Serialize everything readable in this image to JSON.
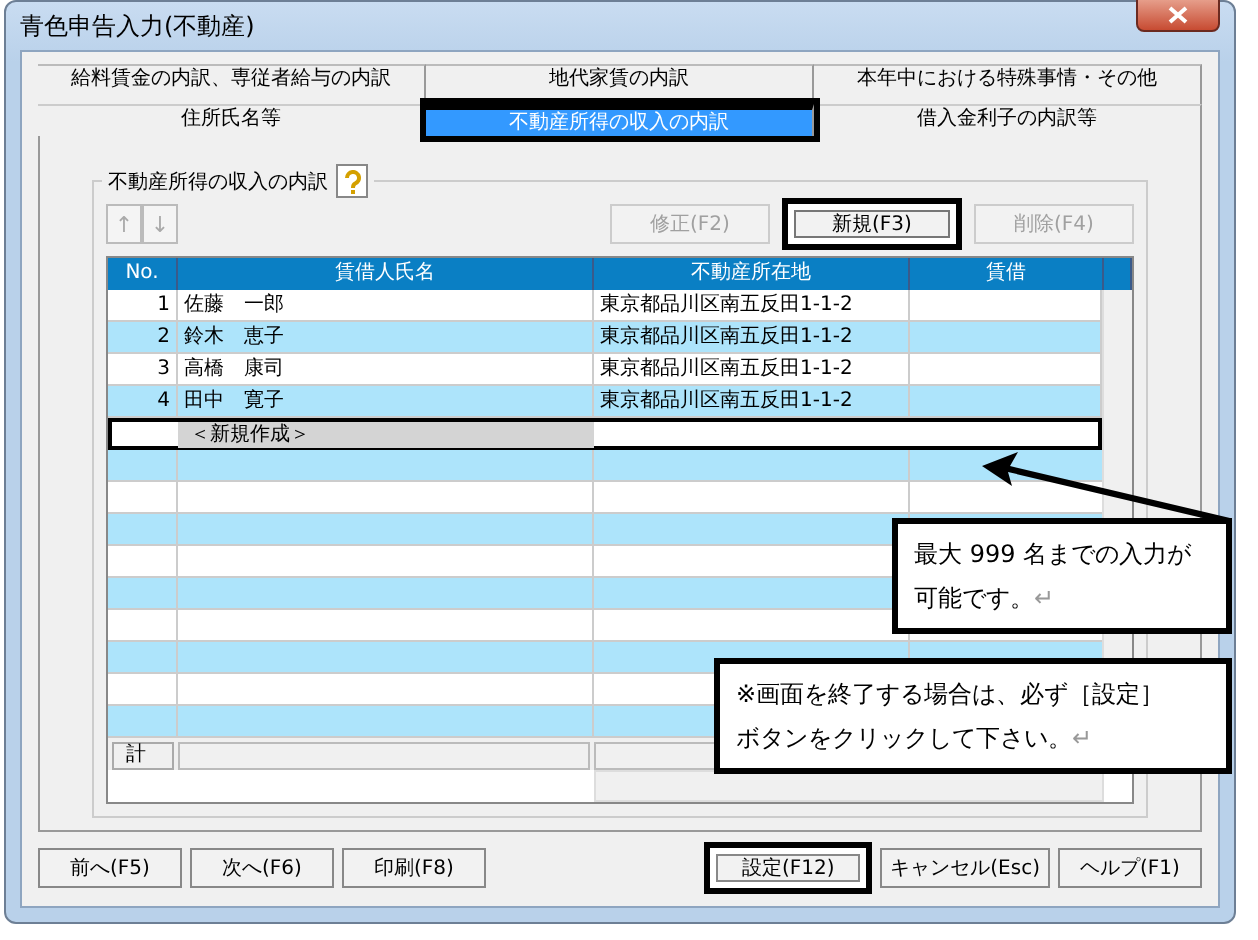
{
  "window": {
    "title": "青色申告入力(不動産)"
  },
  "tabs_back": [
    {
      "label": "給料賃金の内訳、専従者給与の内訳",
      "selected": false
    },
    {
      "label": "地代家賃の内訳",
      "selected": false
    },
    {
      "label": "本年中における特殊事情・その他",
      "selected": false
    }
  ],
  "tabs_front": [
    {
      "label": "住所氏名等",
      "selected": false
    },
    {
      "label": "不動産所得の収入の内訳",
      "selected": true
    },
    {
      "label": "借入金利子の内訳等",
      "selected": false
    }
  ],
  "section": {
    "title": "不動産所得の収入の内訳"
  },
  "move_buttons": [
    {
      "label": "↑",
      "disabled": true
    },
    {
      "label": "↓",
      "disabled": true
    }
  ],
  "action_buttons": [
    {
      "label": "修正(F2)",
      "disabled": true,
      "highlighted": false
    },
    {
      "label": "新規(F3)",
      "disabled": false,
      "highlighted": true
    },
    {
      "label": "削除(F4)",
      "disabled": true,
      "highlighted": false
    }
  ],
  "table": {
    "columns": [
      "No.",
      "賃借人氏名",
      "不動産所在地",
      "賃借"
    ],
    "rows": [
      {
        "no": "1",
        "name": "佐藤　一郎",
        "address": "東京都品川区南五反田1-1-2"
      },
      {
        "no": "2",
        "name": "鈴木　恵子",
        "address": "東京都品川区南五反田1-1-2"
      },
      {
        "no": "3",
        "name": "高橋　康司",
        "address": "東京都品川区南五反田1-1-2"
      },
      {
        "no": "4",
        "name": "田中　寛子",
        "address": "東京都品川区南五反田1-1-2"
      }
    ],
    "new_row": {
      "label": "＜新規作成＞",
      "selected": true
    },
    "total_label": "計"
  },
  "footer_buttons": [
    {
      "label": "前へ(F5)",
      "highlighted": false
    },
    {
      "label": "次へ(F6)",
      "highlighted": false
    },
    {
      "label": "印刷(F8)",
      "highlighted": false
    },
    {
      "label": "設定(F12)",
      "highlighted": true
    },
    {
      "label": "キャンセル(Esc)",
      "highlighted": false
    },
    {
      "label": "ヘルプ(F1)",
      "highlighted": false
    }
  ],
  "callouts": [
    {
      "lines": [
        "最大 999 名までの入力が",
        "可能です。"
      ],
      "end_mark": "↵"
    },
    {
      "lines": [
        "※画面を終了する場合は、必ず［設定］",
        "ボタンをクリックして下さい。"
      ],
      "end_mark": "↵"
    }
  ]
}
